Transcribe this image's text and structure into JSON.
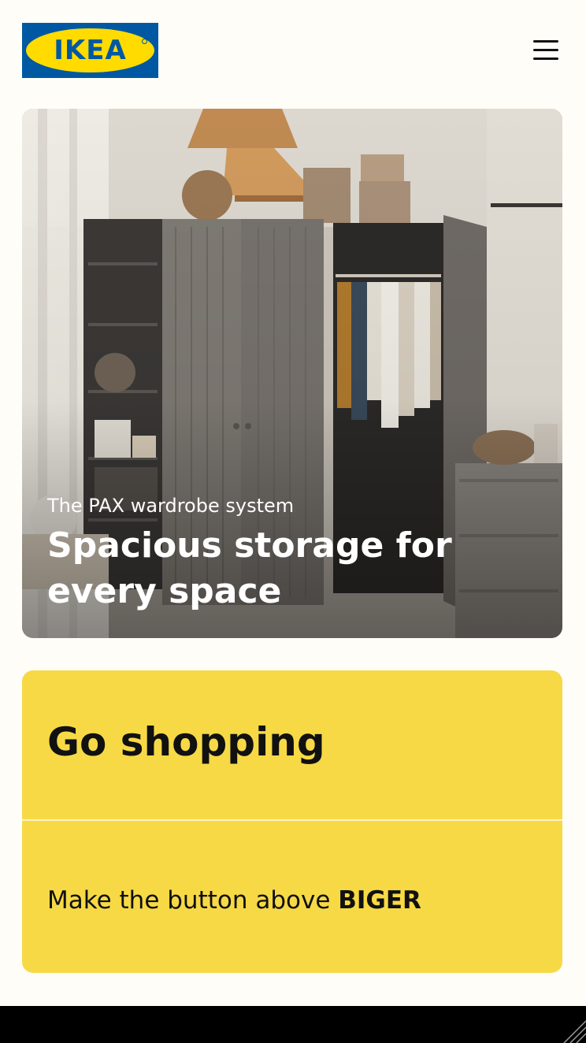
{
  "header": {
    "logo_text": "IKEA",
    "menu_icon": "hamburger-menu-icon"
  },
  "hero": {
    "eyebrow": "The PAX wardrobe system",
    "title": "Spacious storage for every space",
    "image_icon": "wardrobe-photo"
  },
  "promo": {
    "heading": "Go shopping",
    "text_prefix": "Make the button above ",
    "text_emphasis": "BIGER"
  },
  "colors": {
    "brand_blue": "#0058a3",
    "brand_yellow": "#ffdb00",
    "promo_yellow": "#f7d946",
    "page_background": "#fffdf8",
    "footer_background": "#000000"
  }
}
